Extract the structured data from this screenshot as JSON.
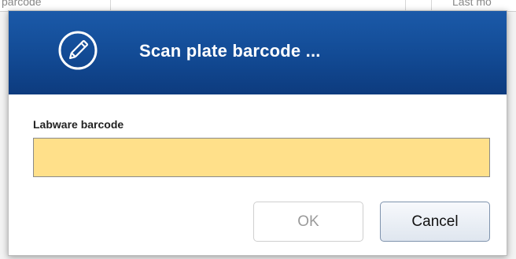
{
  "background": {
    "column_fragments": [
      "parcode",
      "Last mo"
    ]
  },
  "dialog": {
    "title": "Scan plate barcode ...",
    "header_icon": "pencil-icon",
    "field_label": "Labware barcode",
    "barcode_value": "",
    "barcode_placeholder": "",
    "ok_label": "OK",
    "cancel_label": "Cancel",
    "ok_enabled": false
  },
  "colors": {
    "header": "#124a94",
    "input_background": "#ffe08a",
    "title_text": "#ffffff"
  }
}
